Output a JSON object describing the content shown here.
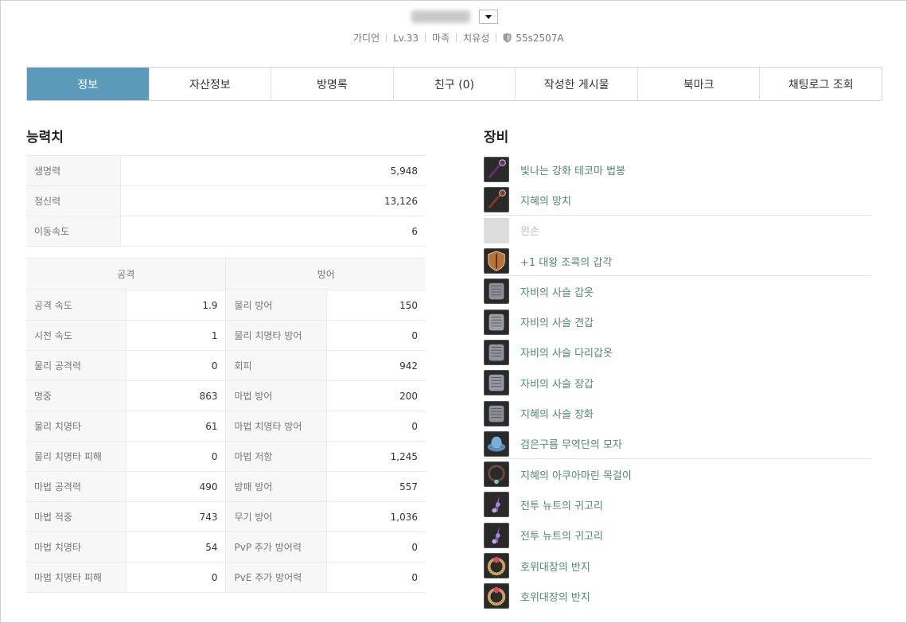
{
  "header": {
    "name_blurred": true,
    "meta": [
      "가디언",
      "Lv.33",
      "마족",
      "치유성"
    ],
    "guild": "55s2507A"
  },
  "tabs": [
    {
      "label": "정보",
      "active": true
    },
    {
      "label": "자산정보"
    },
    {
      "label": "방명록"
    },
    {
      "label": "친구 (0)"
    },
    {
      "label": "작성한 게시물"
    },
    {
      "label": "북마크"
    },
    {
      "label": "채팅로그 조회"
    }
  ],
  "stats": {
    "title": "능력치",
    "basic": [
      {
        "label": "생명력",
        "value": "5,948"
      },
      {
        "label": "정신력",
        "value": "13,126"
      },
      {
        "label": "이동속도",
        "value": "6"
      }
    ],
    "attack_header": "공격",
    "defense_header": "방어",
    "rows": [
      {
        "atk_label": "공격 속도",
        "atk_value": "1.9",
        "def_label": "물리 방어",
        "def_value": "150"
      },
      {
        "atk_label": "시전 속도",
        "atk_value": "1",
        "def_label": "물리 치명타 방어",
        "def_value": "0"
      },
      {
        "atk_label": "물리 공격력",
        "atk_value": "0",
        "def_label": "회피",
        "def_value": "942"
      },
      {
        "atk_label": "명중",
        "atk_value": "863",
        "def_label": "마법 방어",
        "def_value": "200"
      },
      {
        "atk_label": "물리 치명타",
        "atk_value": "61",
        "def_label": "마법 치명타 방어",
        "def_value": "0"
      },
      {
        "atk_label": "물리 치명타 피해",
        "atk_value": "0",
        "def_label": "마법 저항",
        "def_value": "1,245"
      },
      {
        "atk_label": "마법 공격력",
        "atk_value": "490",
        "def_label": "방패 방어",
        "def_value": "557"
      },
      {
        "atk_label": "마법 적중",
        "atk_value": "743",
        "def_label": "무기 방어",
        "def_value": "1,036"
      },
      {
        "atk_label": "마법 치명타",
        "atk_value": "54",
        "def_label": "PvP 추가 방어력",
        "def_value": "0"
      },
      {
        "atk_label": "마법 치명타 피해",
        "atk_value": "0",
        "def_label": "PvE 추가 방어력",
        "def_value": "0"
      }
    ]
  },
  "equipment": {
    "title": "장비",
    "items": [
      {
        "name": "빛나는 강화 테코마 법봉",
        "icon": "staff-icon",
        "color": "#6a2a7a"
      },
      {
        "name": "지혜의 망치",
        "icon": "mace-icon",
        "color": "#8a3a1a",
        "sep": true
      },
      {
        "name": "왼손",
        "icon": "empty-slot-icon",
        "empty": true
      },
      {
        "name": "+1 대왕 조콕의 갑각",
        "icon": "shield-item-icon",
        "color": "#b8743a",
        "sep": true
      },
      {
        "name": "자비의 사슬 갑옷",
        "icon": "chain-armor-icon",
        "color": "#8a8f98"
      },
      {
        "name": "자비의 사슬 견갑",
        "icon": "chain-shoulder-icon",
        "color": "#9aa0a8"
      },
      {
        "name": "자비의 사슬 다리갑옷",
        "icon": "chain-legs-icon",
        "color": "#8e949c"
      },
      {
        "name": "자비의 사슬 장갑",
        "icon": "chain-gloves-icon",
        "color": "#949aa2"
      },
      {
        "name": "지혜의 사슬 장화",
        "icon": "chain-boots-icon",
        "color": "#8a9098"
      },
      {
        "name": "검은구름 무역단의 모자",
        "icon": "hat-icon",
        "color": "#5a8ab8",
        "sep": true
      },
      {
        "name": "지혜의 아쿠아마린 목걸이",
        "icon": "necklace-icon",
        "color": "#6a4a3a"
      },
      {
        "name": "전투 뉴트의 귀고리",
        "icon": "earring-icon",
        "color": "#7a5aa8"
      },
      {
        "name": "전투 뉴트의 귀고리",
        "icon": "earring-icon",
        "color": "#7a5aa8"
      },
      {
        "name": "호위대장의 반지",
        "icon": "ring-icon",
        "color": "#c8a060"
      },
      {
        "name": "호위대장의 반지",
        "icon": "ring-icon",
        "color": "#c8a060"
      }
    ]
  }
}
